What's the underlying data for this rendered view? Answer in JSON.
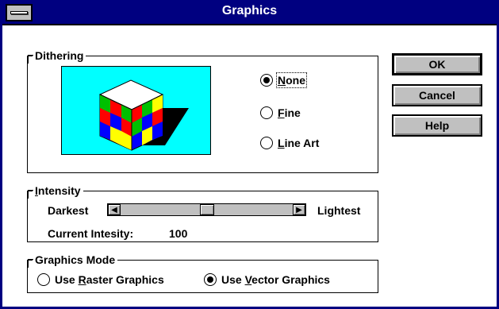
{
  "window": {
    "title": "Graphics"
  },
  "dithering": {
    "label": "Dithering",
    "options": [
      {
        "pre": "",
        "accel": "N",
        "post": "one",
        "selected": true
      },
      {
        "pre": "",
        "accel": "F",
        "post": "ine",
        "selected": false
      },
      {
        "pre": "",
        "accel": "L",
        "post": "ine Art",
        "selected": false
      }
    ]
  },
  "intensity": {
    "label_accel": "I",
    "label_rest": "ntensity",
    "min_label": "Darkest",
    "max_label": "Lightest",
    "current_label": "Current Intesity:",
    "current_value": "100",
    "slider_position": 0.5
  },
  "mode": {
    "label": "Graphics Mode",
    "raster": {
      "pre": "Use ",
      "accel": "R",
      "post": "aster Graphics",
      "selected": false
    },
    "vector": {
      "pre": "Use ",
      "accel": "V",
      "post": "ector Graphics",
      "selected": true
    }
  },
  "buttons": {
    "ok": "OK",
    "cancel": "Cancel",
    "help": "Help"
  },
  "colors": {
    "titlebar": "#000080",
    "preview_bg": "#00ffff",
    "button_face": "#c0c0c0"
  }
}
